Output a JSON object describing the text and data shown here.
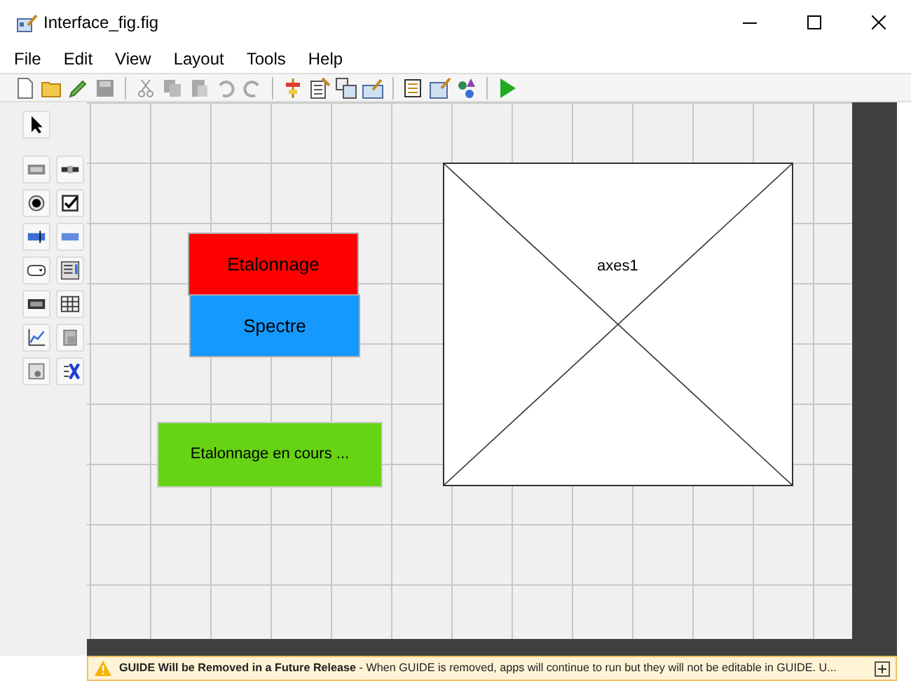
{
  "window": {
    "title": "Interface_fig.fig"
  },
  "menu": [
    "File",
    "Edit",
    "View",
    "Layout",
    "Tools",
    "Help"
  ],
  "components": [
    {
      "kind": "pushbutton",
      "label": "Etalonnage",
      "color": "#ff0000"
    },
    {
      "kind": "pushbutton",
      "label": "Spectre",
      "color": "#1699ff"
    },
    {
      "kind": "text",
      "label": "Etalonnage en cours ...",
      "color": "#66d314"
    },
    {
      "kind": "axes",
      "label": "axes1"
    }
  ],
  "warning": {
    "message": "**GUIDE Will be Removed in a Future Release** - When GUIDE is removed, apps will continue to run but they will not be editable in GUIDE.  U..."
  }
}
